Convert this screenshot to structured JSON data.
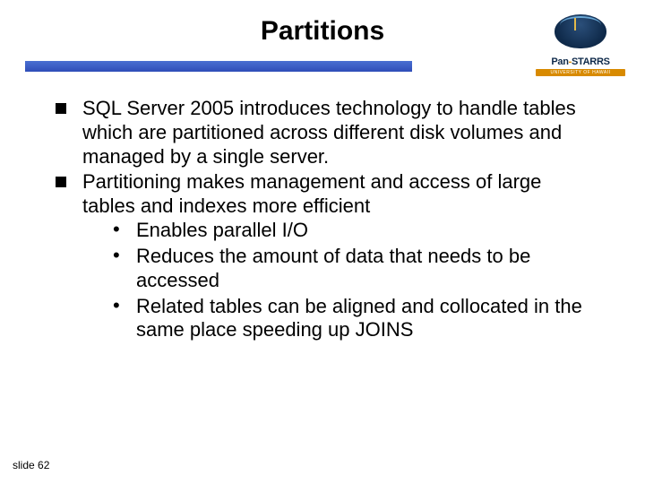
{
  "title": "Partitions",
  "logo": {
    "brand_prefix": "Pan",
    "brand_hyphen": "-",
    "brand_suffix": "STARRS",
    "subtitle": "UNIVERSITY OF HAWAII"
  },
  "bullets": [
    {
      "text": "SQL Server 2005 introduces technology to handle tables which are partitioned across different disk volumes and managed by a single server."
    },
    {
      "text": "Partitioning makes management and access of  large tables and indexes more efficient",
      "sub": [
        "Enables parallel I/O",
        "Reduces the amount of data that needs to be accessed",
        "Related tables can be aligned and collocated in the same place speeding up JOINS"
      ]
    }
  ],
  "footer": "slide 62"
}
